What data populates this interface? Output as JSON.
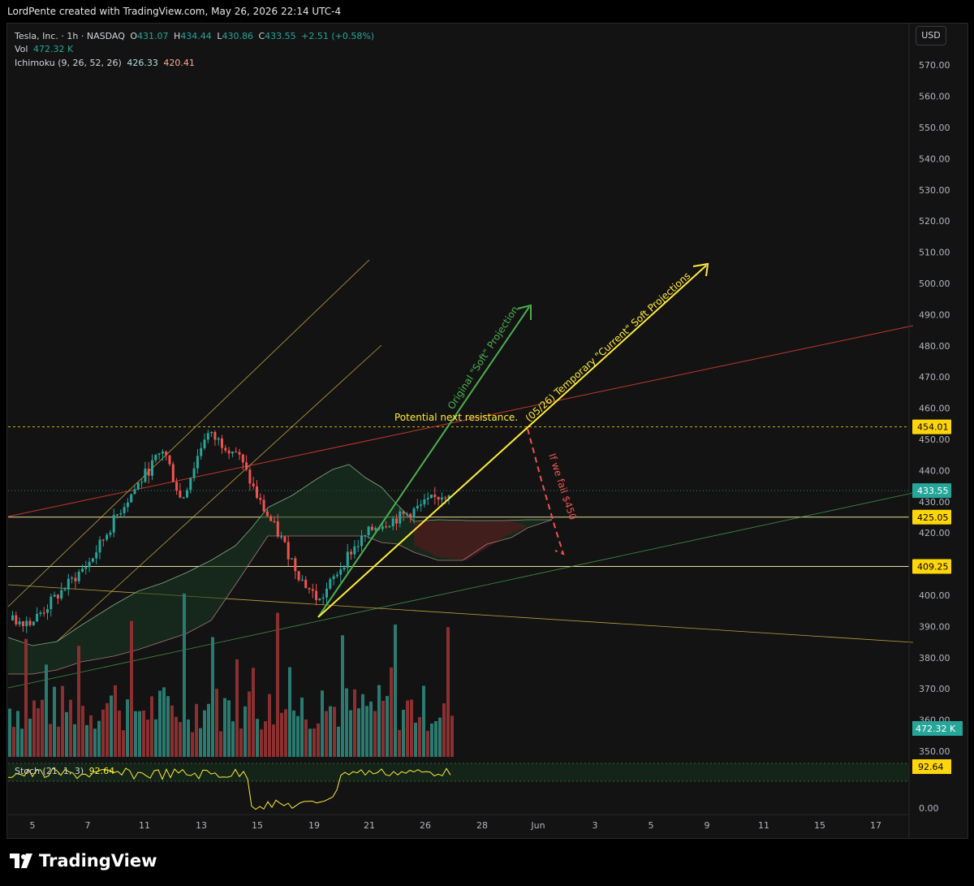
{
  "header": {
    "attribution": "LordPente created with TradingView.com, May 26, 2026 22:14 UTC-4"
  },
  "currency": "USD",
  "legend": {
    "symbol": "Tesla, Inc. · 1h · NASDAQ",
    "o_label": "O",
    "open": "431.07",
    "h_label": "H",
    "high": "434.44",
    "l_label": "L",
    "low": "430.86",
    "c_label": "C",
    "close": "433.55",
    "change": "+2.51 (+0.58%)",
    "vol_label": "Vol",
    "vol_value": "472.32 K",
    "ichimoku_label": "Ichimoku (9, 26, 52, 26)",
    "ichimoku_val1": "426.33",
    "ichimoku_val2": "420.41",
    "stoch_label": "Stoch (21, 1, 3)",
    "stoch_value": "92.64"
  },
  "price_axis": [
    "570.00",
    "560.00",
    "550.00",
    "540.00",
    "530.00",
    "520.00",
    "510.00",
    "500.00",
    "490.00",
    "480.00",
    "470.00",
    "460.00",
    "450.00",
    "440.00",
    "430.00",
    "420.00",
    "410.00",
    "400.00",
    "390.00",
    "380.00",
    "370.00",
    "360.00",
    "350.00"
  ],
  "stoch_axis": "0.00",
  "badges": [
    {
      "text": "454.01",
      "price": 454.01,
      "color": "#ffd60a",
      "text_color": "#000000"
    },
    {
      "text": "433.55",
      "price": 433.55,
      "color": "#26a69a",
      "text_color": "#ffffff"
    },
    {
      "text": "425.05",
      "price": 425.05,
      "color": "#ffd60a",
      "text_color": "#000000"
    },
    {
      "text": "409.25",
      "price": 409.25,
      "color": "#ffd60a",
      "text_color": "#000000"
    }
  ],
  "volume_badge": "472.32 K",
  "stoch_badge": "92.64",
  "time_axis": [
    "5",
    "7",
    "11",
    "13",
    "15",
    "19",
    "21",
    "26",
    "28",
    "Jun",
    "3",
    "5",
    "9",
    "11",
    "15",
    "17"
  ],
  "annotations": {
    "resistance": "Potential next resistance.",
    "original": "Original \"Soft\" Projection",
    "current": "(05/26) Temporary \"Current\" Soft Projections",
    "fail": "If we fail $450"
  },
  "colors": {
    "bull": "#26a69a",
    "bear": "#ef5350",
    "yellow": "#ffeb3b",
    "green_arrow": "#4caf50",
    "red_line": "#c0392b",
    "cloud_green": "#1b3a26",
    "cloud_red": "#3a1b1b"
  },
  "brand": "TradingView",
  "chart_data": {
    "type": "candlestick",
    "symbol": "Tesla, Inc.",
    "interval": "1h",
    "exchange": "NASDAQ",
    "y_range": [
      345,
      575
    ],
    "horizontal_levels": [
      454.01,
      425.05,
      409.25
    ],
    "last_price": 433.55,
    "stoch_last": 92.64,
    "anchor_closes": [
      {
        "date": "5",
        "close": 392
      },
      {
        "date": "7",
        "close": 411
      },
      {
        "date": "9",
        "close": 428
      },
      {
        "date": "11",
        "close": 447
      },
      {
        "date": "12",
        "close": 430
      },
      {
        "date": "13",
        "close": 452
      },
      {
        "date": "14",
        "close": 446
      },
      {
        "date": "15",
        "close": 430
      },
      {
        "date": "16",
        "close": 418
      },
      {
        "date": "18",
        "close": 405
      },
      {
        "date": "19",
        "close": 398
      },
      {
        "date": "20",
        "close": 414
      },
      {
        "date": "21",
        "close": 422
      },
      {
        "date": "22",
        "close": 426
      },
      {
        "date": "26",
        "close": 433.55
      }
    ]
  }
}
